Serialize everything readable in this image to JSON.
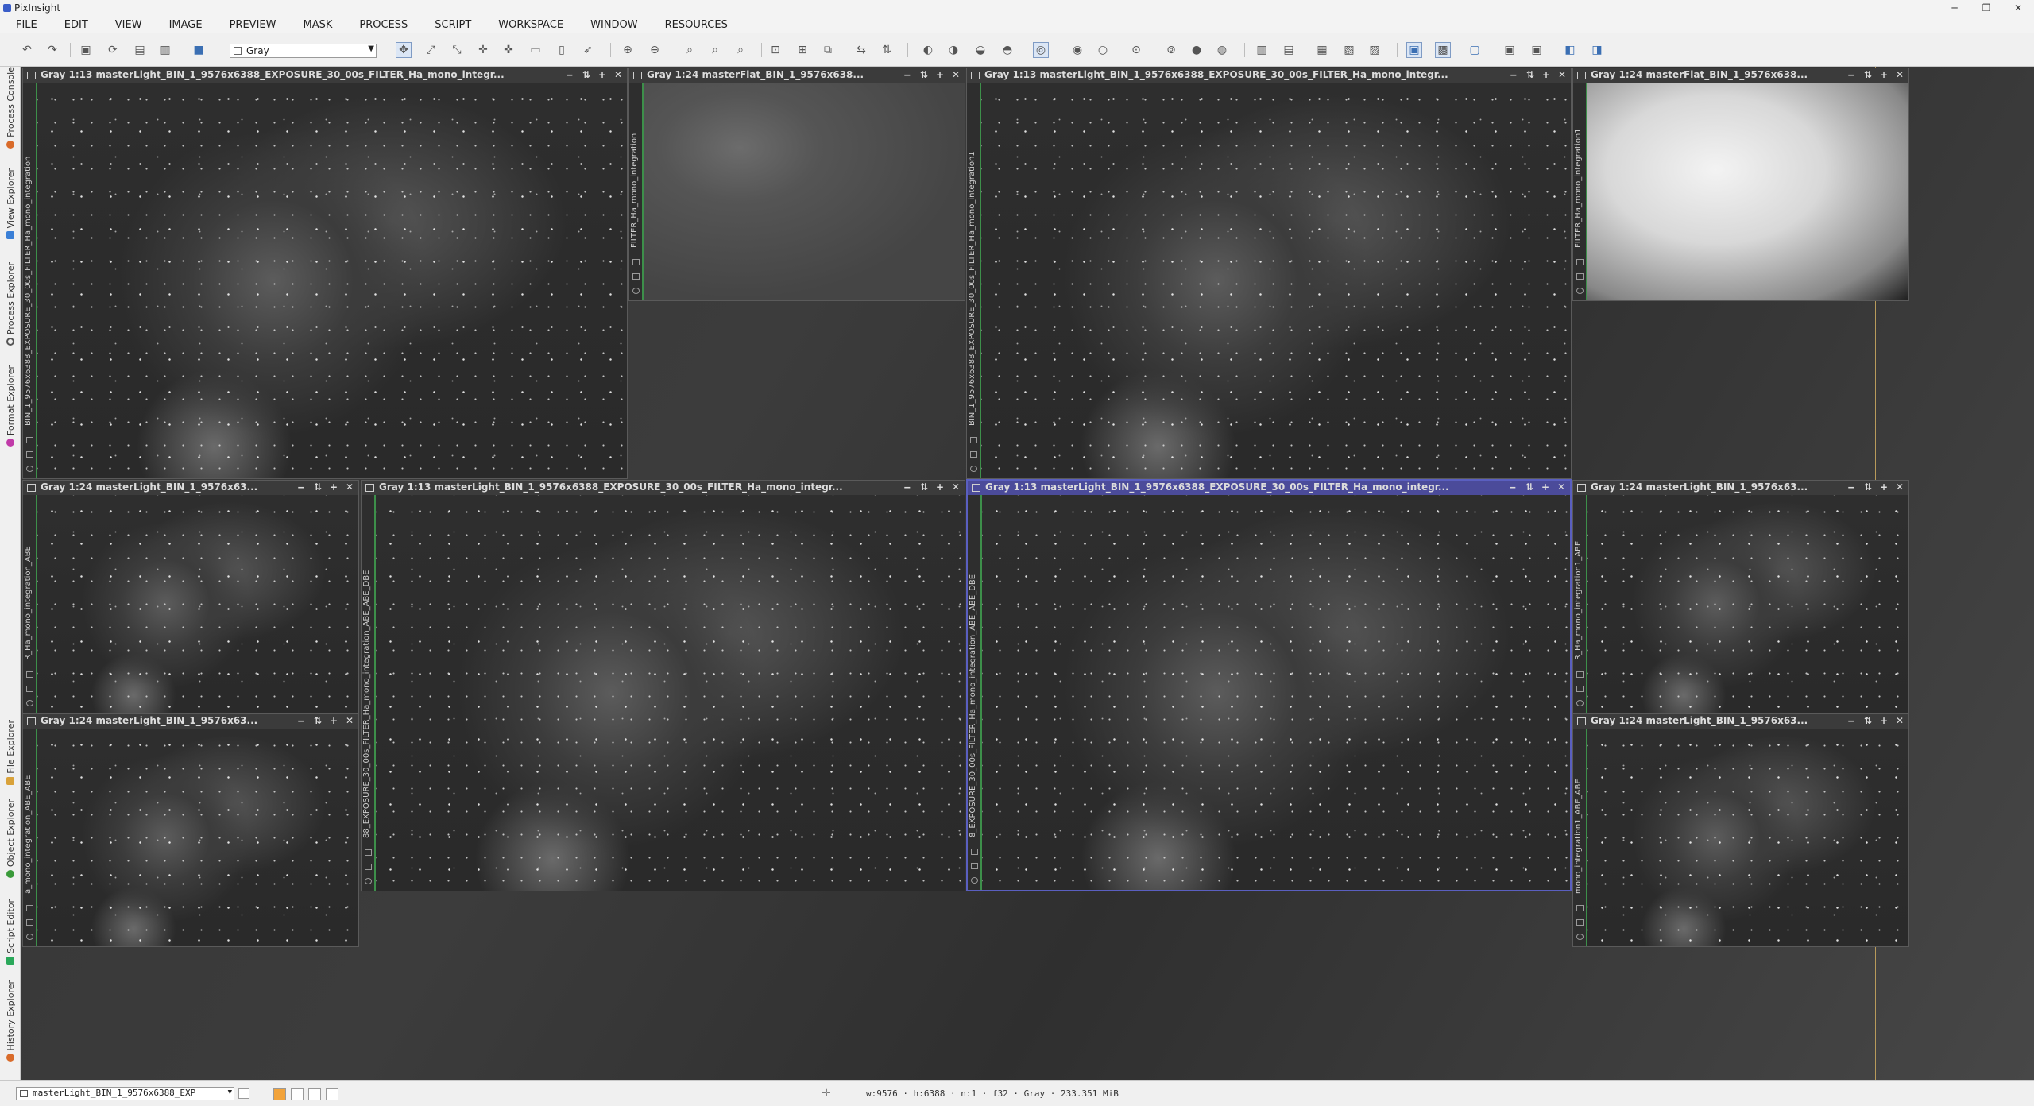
{
  "app": {
    "title": "PixInsight",
    "window_controls": [
      "─",
      "❐",
      "✕"
    ]
  },
  "menu": [
    "FILE",
    "EDIT",
    "VIEW",
    "IMAGE",
    "PREVIEW",
    "MASK",
    "PROCESS",
    "SCRIPT",
    "WORKSPACE",
    "WINDOW",
    "RESOURCES"
  ],
  "toolbar": {
    "color_mode": "Gray"
  },
  "sidebar": {
    "tabs": [
      {
        "label": "Process Console",
        "icon_color": "#d96b2a"
      },
      {
        "label": "View Explorer",
        "icon_color": "#3a7fd6"
      },
      {
        "label": "Process Explorer",
        "icon_color": "#555555"
      },
      {
        "label": "Format Explorer",
        "icon_color": "#c03aa8"
      },
      {
        "label": "File Explorer",
        "icon_color": "#d9a23a"
      },
      {
        "label": "Object Explorer",
        "icon_color": "#3a9a3a"
      },
      {
        "label": "Script Editor",
        "icon_color": "#2aa85a"
      },
      {
        "label": "History Explorer",
        "icon_color": "#d96b2a"
      }
    ]
  },
  "image_windows": [
    {
      "title": "Gray 1:13 masterLight_BIN_1_9576x6388_EXPOSURE_30_00s_FILTER_Ha_mono_integr...",
      "view_id": "BIN_1_9576x6388_EXPOSURE_30_00s_FILTER_Ha_mono_integration",
      "kind": "light",
      "active": false
    },
    {
      "title": "Gray 1:24 masterFlat_BIN_1_9576x638...",
      "view_id": "FILTER_Ha_mono_integration",
      "kind": "flat1",
      "active": false
    },
    {
      "title": "Gray 1:13 masterLight_BIN_1_9576x6388_EXPOSURE_30_00s_FILTER_Ha_mono_integr...",
      "view_id": "BIN_1_9576x6388_EXPOSURE_30_00s_FILTER_Ha_mono_integration1",
      "kind": "light",
      "active": false
    },
    {
      "title": "Gray 1:24 masterFlat_BIN_1_9576x638...",
      "view_id": "FILTER_Ha_mono_integration1",
      "kind": "flat2",
      "active": false
    },
    {
      "title": "Gray 1:24 masterLight_BIN_1_9576x63...",
      "view_id": "R_Ha_mono_integration_ABE",
      "kind": "light",
      "active": false
    },
    {
      "title": "Gray 1:13 masterLight_BIN_1_9576x6388_EXPOSURE_30_00s_FILTER_Ha_mono_integr...",
      "view_id": "88_EXPOSURE_30_00s_FILTER_Ha_mono_integration_ABE_ABE_DBE",
      "kind": "light",
      "active": false
    },
    {
      "title": "Gray 1:13 masterLight_BIN_1_9576x6388_EXPOSURE_30_00s_FILTER_Ha_mono_integr...",
      "view_id": "8_EXPOSURE_30_00s_FILTER_Ha_mono_integration_ABE_ABE_DBE",
      "kind": "light",
      "active": true
    },
    {
      "title": "Gray 1:24 masterLight_BIN_1_9576x63...",
      "view_id": "R_Ha_mono_integration1_ABE",
      "kind": "light",
      "active": false
    },
    {
      "title": "Gray 1:24 masterLight_BIN_1_9576x63...",
      "view_id": "a_mono_integration_ABE_ABE",
      "kind": "light",
      "active": false
    },
    {
      "title": "Gray 1:24 masterLight_BIN_1_9576x63...",
      "view_id": "mono_integration1_ABE_ABE",
      "kind": "light",
      "active": false
    }
  ],
  "window_buttons": [
    "‒",
    "⇅",
    "+",
    "✕"
  ],
  "status": {
    "view_name": "masterLight_BIN_1_9576x6388_EXP",
    "image_info": "w:9576 · h:6388 · n:1 · f32 · Gray · 233.351 MiB",
    "swatch_colors": [
      "#f2a33a",
      "#ffffff",
      "#ffffff",
      "#ffffff"
    ]
  }
}
